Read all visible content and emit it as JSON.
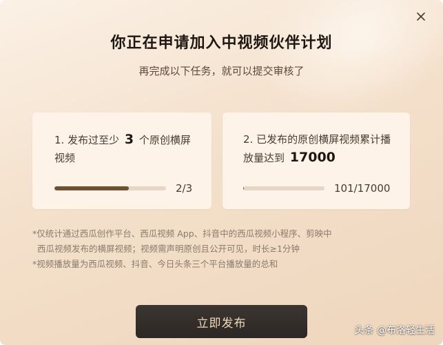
{
  "dialog": {
    "title": "你正在申请加入中视频伙伴计划",
    "subtitle": "再完成以下任务，就可以提交审核了"
  },
  "tasks": [
    {
      "text_pre": "1. 发布过至少",
      "highlight": "3",
      "text_post": "个原创横屏视频",
      "progress_current": 2,
      "progress_total": 3,
      "count_text": "2/3",
      "progress_fraction": 0.667
    },
    {
      "text_pre": "2. 已发布的原创横屏视频累计播放量达到",
      "highlight": "17000",
      "text_post": "",
      "progress_current": 101,
      "progress_total": 17000,
      "count_text": "101/17000",
      "progress_fraction": 0.006
    }
  ],
  "notes": {
    "line1": "*仅统计通过西瓜创作平台、西瓜视频 App、抖音中的西瓜视频小程序、剪映中",
    "line2": "西瓜视频发布的横屏视频；视频需声明原创且公开可见，时长≥1分钟",
    "line3": "*视频播放量为西瓜视频、抖音、今日头条三个平台播放量的总和"
  },
  "button": {
    "label": "立即发布"
  },
  "watermark": {
    "text": "头条 @布洛轻生活"
  },
  "colors": {
    "progress_fill": "#6f5232",
    "button_bg": "#2c2724",
    "button_text": "#f1d9b8"
  },
  "icons": {
    "close": "close-icon"
  }
}
